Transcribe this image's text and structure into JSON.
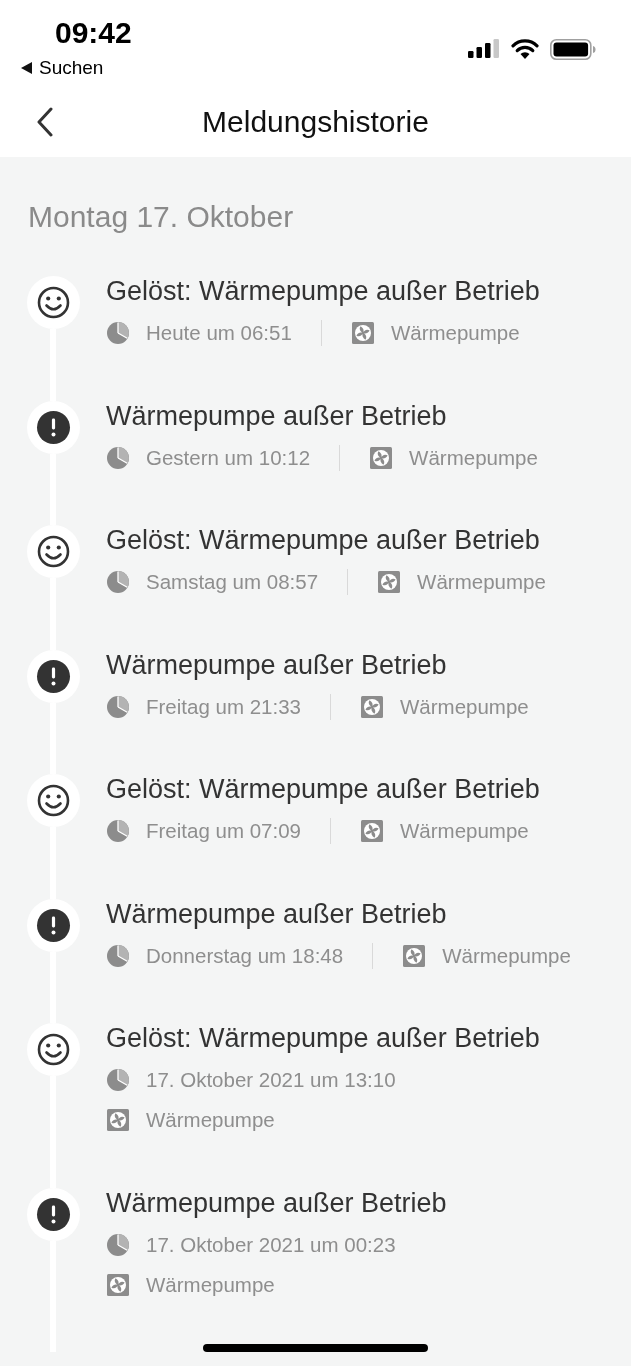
{
  "status_bar": {
    "time": "09:42",
    "back_label": "Suchen"
  },
  "nav": {
    "title": "Meldungshistorie"
  },
  "sections": [
    {
      "heading": "Montag 17. Oktober",
      "items": [
        {
          "kind": "resolved",
          "stacked": false,
          "title": "Gelöst: Wärmepumpe außer Betrieb",
          "time": "Heute um 06:51",
          "device": "Wärmepumpe"
        },
        {
          "kind": "alert",
          "stacked": false,
          "title": "Wärmepumpe außer Betrieb",
          "time": "Gestern um 10:12",
          "device": "Wärmepumpe"
        },
        {
          "kind": "resolved",
          "stacked": false,
          "title": "Gelöst: Wärmepumpe außer Betrieb",
          "time": "Samstag um 08:57",
          "device": "Wärmepumpe"
        },
        {
          "kind": "alert",
          "stacked": false,
          "title": "Wärmepumpe außer Betrieb",
          "time": "Freitag um 21:33",
          "device": "Wärmepumpe"
        },
        {
          "kind": "resolved",
          "stacked": false,
          "title": "Gelöst: Wärmepumpe außer Betrieb",
          "time": "Freitag um 07:09",
          "device": "Wärmepumpe"
        },
        {
          "kind": "alert",
          "stacked": false,
          "title": "Wärmepumpe außer Betrieb",
          "time": "Donnerstag um 18:48",
          "device": "Wärmepumpe"
        },
        {
          "kind": "resolved",
          "stacked": true,
          "title": "Gelöst: Wärmepumpe außer Betrieb",
          "time": "17. Oktober 2021 um 13:10",
          "device": "Wärmepumpe"
        },
        {
          "kind": "alert",
          "stacked": true,
          "title": "Wärmepumpe außer Betrieb",
          "time": "17. Oktober 2021 um 00:23",
          "device": "Wärmepumpe"
        }
      ]
    }
  ]
}
